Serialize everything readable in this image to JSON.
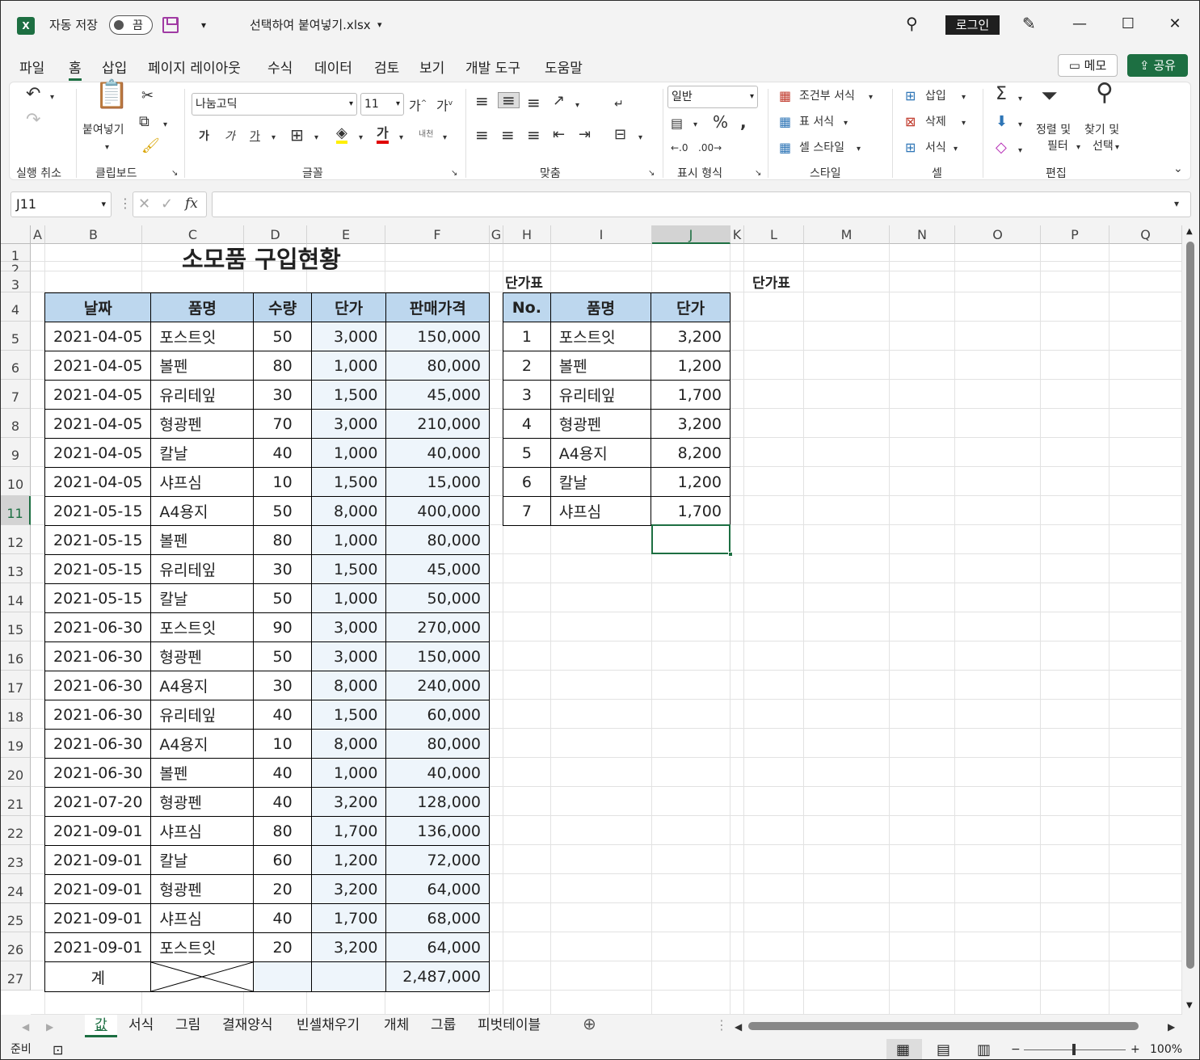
{
  "title_bar": {
    "app_icon": "X",
    "autosave_label": "자동 저장",
    "autosave_state": "끔",
    "filename": "선택하여 붙여넣기.xlsx",
    "login": "로그인"
  },
  "menu": {
    "tabs": [
      "파일",
      "홈",
      "삽입",
      "페이지 레이아웃",
      "수식",
      "데이터",
      "검토",
      "보기",
      "개발 도구",
      "도움말"
    ],
    "active": "홈",
    "memo": "메모",
    "share": "공유"
  },
  "ribbon": {
    "groups": {
      "undo": "실행 취소",
      "clipboard": "클립보드",
      "font": "글꼴",
      "align": "맞춤",
      "number": "표시 형식",
      "styles": "스타일",
      "cells": "셀",
      "editing": "편집"
    },
    "paste": "붙여넣기",
    "font_name": "나눔고딕",
    "font_size": "11",
    "number_format": "일반",
    "conditional": "조건부 서식",
    "table_format": "표 서식",
    "cell_style": "셀 스타일",
    "insert": "삽입",
    "delete": "삭제",
    "format": "서식",
    "sort_filter_1": "정렬 및",
    "sort_filter_2": "필터",
    "find_1": "찾기 및",
    "find_2": "선택",
    "bold": "가",
    "italic": "가",
    "underline": "가",
    "font_color_glyph": "가",
    "wrap_text": "내천"
  },
  "formula_bar": {
    "name_box": "J11",
    "fx": "fx",
    "content": ""
  },
  "grid": {
    "columns": [
      "A",
      "B",
      "C",
      "D",
      "E",
      "F",
      "G",
      "H",
      "I",
      "J",
      "K",
      "L",
      "M",
      "N",
      "O",
      "P",
      "Q"
    ],
    "rows": [
      "1",
      "2",
      "3",
      "4",
      "5",
      "6",
      "7",
      "8",
      "9",
      "10",
      "11",
      "12",
      "13",
      "14",
      "15",
      "16",
      "17",
      "18",
      "19",
      "20",
      "21",
      "22",
      "23",
      "24",
      "25",
      "26",
      "27"
    ],
    "title": "소모품 구입현황",
    "label_h2": "단가표",
    "label_l2": "단가표"
  },
  "main_table": {
    "headers": [
      "날짜",
      "품명",
      "수량",
      "단가",
      "판매가격"
    ],
    "rows": [
      [
        "2021-04-05",
        "포스트잇",
        "50",
        "3,000",
        "150,000"
      ],
      [
        "2021-04-05",
        "볼펜",
        "80",
        "1,000",
        "80,000"
      ],
      [
        "2021-04-05",
        "유리테잎",
        "30",
        "1,500",
        "45,000"
      ],
      [
        "2021-04-05",
        "형광펜",
        "70",
        "3,000",
        "210,000"
      ],
      [
        "2021-04-05",
        "칼날",
        "40",
        "1,000",
        "40,000"
      ],
      [
        "2021-04-05",
        "샤프심",
        "10",
        "1,500",
        "15,000"
      ],
      [
        "2021-05-15",
        "A4용지",
        "50",
        "8,000",
        "400,000"
      ],
      [
        "2021-05-15",
        "볼펜",
        "80",
        "1,000",
        "80,000"
      ],
      [
        "2021-05-15",
        "유리테잎",
        "30",
        "1,500",
        "45,000"
      ],
      [
        "2021-05-15",
        "칼날",
        "50",
        "1,000",
        "50,000"
      ],
      [
        "2021-06-30",
        "포스트잇",
        "90",
        "3,000",
        "270,000"
      ],
      [
        "2021-06-30",
        "형광펜",
        "50",
        "3,000",
        "150,000"
      ],
      [
        "2021-06-30",
        "A4용지",
        "30",
        "8,000",
        "240,000"
      ],
      [
        "2021-06-30",
        "유리테잎",
        "40",
        "1,500",
        "60,000"
      ],
      [
        "2021-06-30",
        "A4용지",
        "10",
        "8,000",
        "80,000"
      ],
      [
        "2021-06-30",
        "볼펜",
        "40",
        "1,000",
        "40,000"
      ],
      [
        "2021-07-20",
        "형광펜",
        "40",
        "3,200",
        "128,000"
      ],
      [
        "2021-09-01",
        "샤프심",
        "80",
        "1,700",
        "136,000"
      ],
      [
        "2021-09-01",
        "칼날",
        "60",
        "1,200",
        "72,000"
      ],
      [
        "2021-09-01",
        "형광펜",
        "20",
        "3,200",
        "64,000"
      ],
      [
        "2021-09-01",
        "샤프심",
        "40",
        "1,700",
        "68,000"
      ],
      [
        "2021-09-01",
        "포스트잇",
        "20",
        "3,200",
        "64,000"
      ]
    ],
    "total_label": "계",
    "total_value": "2,487,000"
  },
  "price_table": {
    "headers": [
      "No.",
      "품명",
      "단가"
    ],
    "rows": [
      [
        "1",
        "포스트잇",
        "3,200"
      ],
      [
        "2",
        "볼펜",
        "1,200"
      ],
      [
        "3",
        "유리테잎",
        "1,700"
      ],
      [
        "4",
        "형광펜",
        "3,200"
      ],
      [
        "5",
        "A4용지",
        "8,200"
      ],
      [
        "6",
        "칼날",
        "1,200"
      ],
      [
        "7",
        "샤프심",
        "1,700"
      ]
    ]
  },
  "sheet_tabs": [
    "값",
    "서식",
    "그림",
    "결재양식",
    "빈셀채우기",
    "개체",
    "그룹",
    "피벗테이블"
  ],
  "active_sheet": "값",
  "status": {
    "ready": "준비",
    "zoom": "100%"
  }
}
